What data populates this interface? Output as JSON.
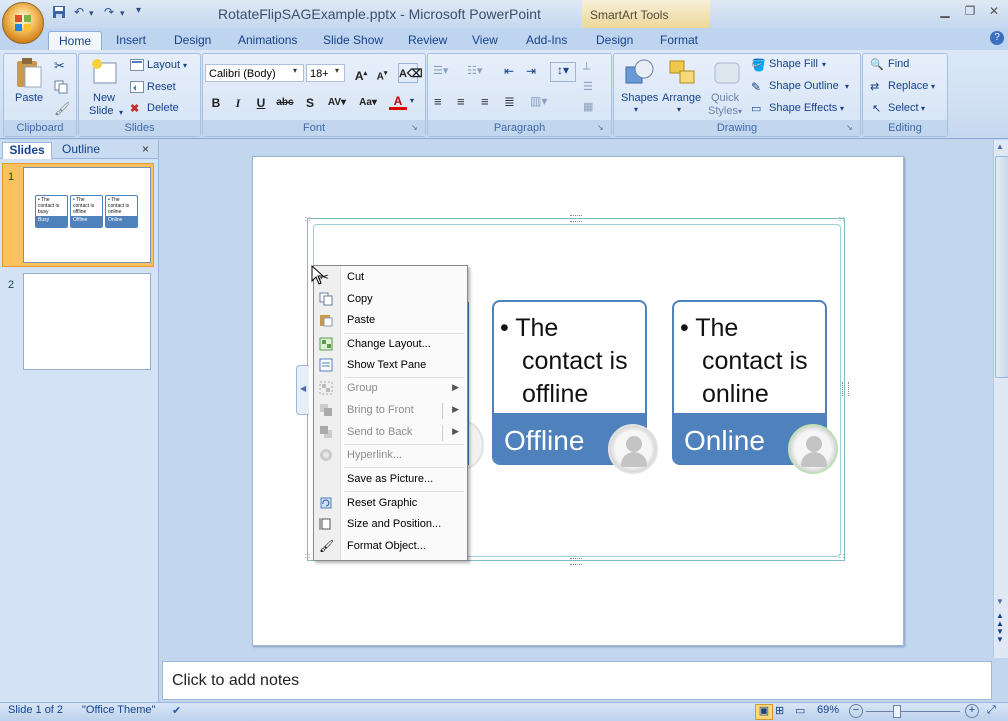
{
  "window": {
    "title": "RotateFlipSAGExample.pptx - Microsoft PowerPoint",
    "context_tab_group": "SmartArt Tools"
  },
  "tabs": [
    "Home",
    "Insert",
    "Design",
    "Animations",
    "Slide Show",
    "Review",
    "View",
    "Add-Ins",
    "Design",
    "Format"
  ],
  "ribbon": {
    "clipboard": {
      "label": "Clipboard",
      "paste": "Paste"
    },
    "slides": {
      "label": "Slides",
      "new_slide_1": "New",
      "new_slide_2": "Slide",
      "layout": "Layout",
      "reset": "Reset",
      "delete": "Delete"
    },
    "font": {
      "label": "Font",
      "font_name": "Calibri (Body)",
      "font_size": "18+"
    },
    "paragraph": {
      "label": "Paragraph"
    },
    "drawing": {
      "label": "Drawing",
      "shapes": "Shapes",
      "arrange": "Arrange",
      "quick_styles_1": "Quick",
      "quick_styles_2": "Styles",
      "shape_fill": "Shape Fill",
      "shape_outline": "Shape Outline",
      "shape_effects": "Shape Effects"
    },
    "editing": {
      "label": "Editing",
      "find": "Find",
      "replace": "Replace",
      "select": "Select"
    }
  },
  "pane": {
    "tab_slides": "Slides",
    "tab_outline": "Outline",
    "slide_numbers": [
      "1",
      "2"
    ]
  },
  "thumb": {
    "cards": [
      {
        "text": "• The contact is busy",
        "label": "Busy"
      },
      {
        "text": "• The contact is offline",
        "label": "Offline"
      },
      {
        "text": "• The contact is online",
        "label": "Online"
      }
    ]
  },
  "smartart": {
    "cards": [
      {
        "lines": [
          "• The",
          "contact is",
          "offline"
        ],
        "label": "Offline"
      },
      {
        "lines": [
          "• The",
          "contact is",
          "online"
        ],
        "label": "Online"
      }
    ]
  },
  "context_menu": {
    "items": [
      {
        "label": "Cut",
        "icon": "scissors-icon",
        "disabled": false
      },
      {
        "label": "Copy",
        "icon": "copy-icon",
        "disabled": false
      },
      {
        "label": "Paste",
        "icon": "paste-icon",
        "disabled": false
      },
      {
        "label": "Change Layout...",
        "icon": "change-layout-icon",
        "disabled": false
      },
      {
        "label": "Show Text Pane",
        "icon": "text-pane-icon",
        "disabled": false
      },
      {
        "label": "Group",
        "icon": "group-icon",
        "disabled": true
      },
      {
        "label": "Bring to Front",
        "icon": "bring-front-icon",
        "disabled": true
      },
      {
        "label": "Send to Back",
        "icon": "send-back-icon",
        "disabled": true
      },
      {
        "label": "Hyperlink...",
        "icon": "hyperlink-icon",
        "disabled": true
      },
      {
        "label": "Save as Picture...",
        "icon": "",
        "disabled": false
      },
      {
        "label": "Reset Graphic",
        "icon": "reset-graphic-icon",
        "disabled": false
      },
      {
        "label": "Size and Position...",
        "icon": "size-position-icon",
        "disabled": false
      },
      {
        "label": "Format Object...",
        "icon": "format-object-icon",
        "disabled": false
      }
    ]
  },
  "notes": {
    "placeholder": "Click to add notes"
  },
  "status": {
    "slide": "Slide 1 of 2",
    "theme": "\"Office Theme\"",
    "zoom": "69%"
  },
  "colors": {
    "accent": "#4f81bd",
    "ribbon_bg": "#cfdff3",
    "selected_thumb": "#fac25f"
  }
}
